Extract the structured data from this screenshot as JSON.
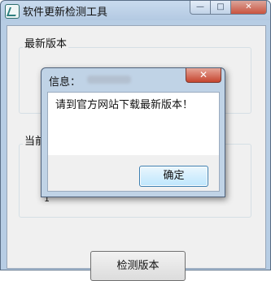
{
  "window": {
    "title": "软件更新检测工具",
    "minimize_glyph": "—",
    "maximize_glyph": "□",
    "close_glyph": "✕"
  },
  "main": {
    "latest_version_label": "最新版本",
    "latest_version_marker": "‹",
    "current_version_label": "当前",
    "current_version_value": "1",
    "check_button_label": "检测版本"
  },
  "dialog": {
    "title": "信息：",
    "close_glyph": "✕",
    "message": "请到官方网站下载最新版本！",
    "ok_button_label": "确定"
  },
  "icons": [
    "app-icon",
    "minimize-icon",
    "maximize-icon",
    "close-icon"
  ]
}
